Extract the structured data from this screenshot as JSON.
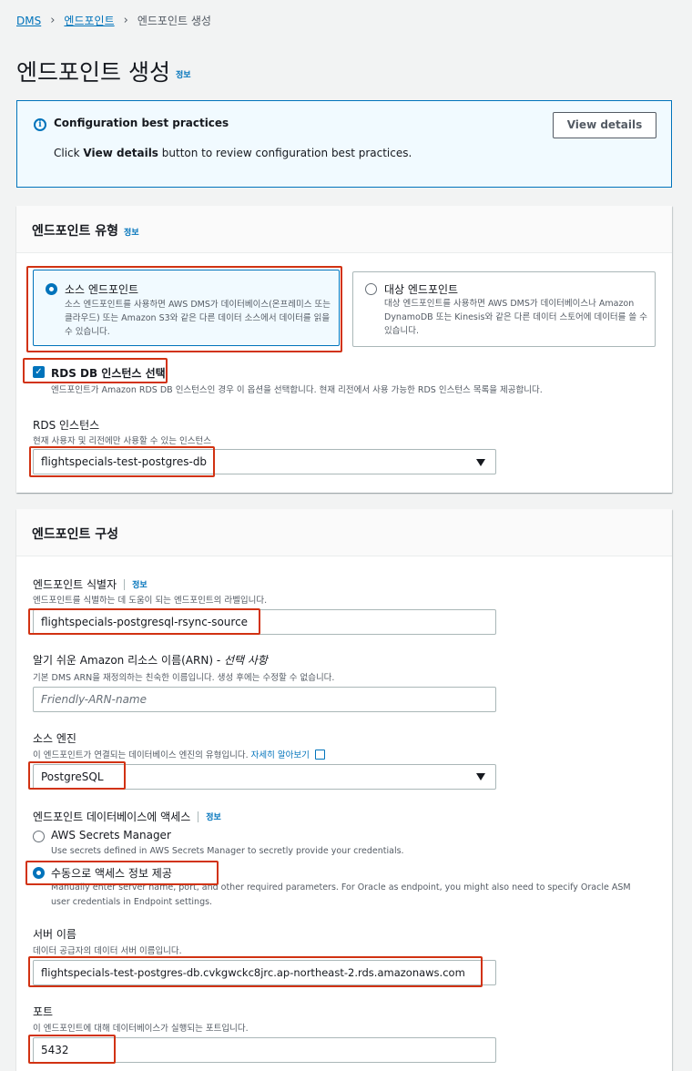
{
  "breadcrumb": {
    "item1": "DMS",
    "item2": "엔드포인트",
    "current": "엔드포인트 생성"
  },
  "page": {
    "title": "엔드포인트 생성",
    "info": "정보"
  },
  "alert": {
    "title": "Configuration best practices",
    "text_prefix": "Click ",
    "text_bold": "View details",
    "text_suffix": " button to review configuration best practices.",
    "button": "View details"
  },
  "endpoint_type": {
    "title": "엔드포인트 유형",
    "info": "정보",
    "source": {
      "title": "소스 엔드포인트",
      "desc": "소스 엔드포인트를 사용하면 AWS DMS가 데이터베이스(온프레미스 또는 클라우드) 또는 Amazon S3와 같은 다른 데이터 소스에서 데이터를 읽을 수 있습니다.",
      "selected": true
    },
    "target": {
      "title": "대상 엔드포인트",
      "desc": "대상 엔드포인트를 사용하면 AWS DMS가 데이터베이스나 Amazon DynamoDB 또는 Kinesis와 같은 다른 데이터 스토어에 데이터를 쓸 수 있습니다.",
      "selected": false
    },
    "rds_checkbox": {
      "label": "RDS DB 인스턴스 선택",
      "desc": "엔드포인트가 Amazon RDS DB 인스턴스인 경우 이 옵션을 선택합니다. 현재 리전에서 사용 가능한 RDS 인스턴스 목록을 제공합니다.",
      "checked": true
    },
    "rds_instance": {
      "label": "RDS 인스턴스",
      "desc": "현재 사용자 및 리전에만 사용할 수 있는 인스턴스",
      "value": "flightspecials-test-postgres-db"
    }
  },
  "endpoint_config": {
    "title": "엔드포인트 구성",
    "identifier": {
      "label": "엔드포인트 식별자",
      "info": "정보",
      "desc": "엔드포인트를 식별하는 데 도움이 되는 엔드포인트의 라벨입니다.",
      "value": "flightspecials-postgresql-rsync-source"
    },
    "arn": {
      "label": "알기 쉬운 Amazon 리소스 이름(ARN) - ",
      "label_optional": "선택 사항",
      "desc": "기본 DMS ARN을 재정의하는 친숙한 이름입니다. 생성 후에는 수정할 수 없습니다.",
      "placeholder": "Friendly-ARN-name"
    },
    "source_engine": {
      "label": "소스 엔진",
      "desc": "이 엔드포인트가 연결되는 데이터베이스 엔진의 유형입니다.",
      "learn_more": "자세히 알아보기",
      "value": "PostgreSQL"
    },
    "access": {
      "label": "엔드포인트 데이터베이스에 액세스",
      "info": "정보",
      "option1": {
        "title": "AWS Secrets Manager",
        "desc": "Use secrets defined in AWS Secrets Manager to secretly provide your credentials.",
        "selected": false
      },
      "option2": {
        "title": "수동으로 액세스 정보 제공",
        "desc_line1": "Manually enter server name, port, and other required parameters. For Oracle as endpoint, you might also need to specify Oracle ASM",
        "desc_line2": "user credentials in Endpoint settings.",
        "selected": true
      }
    },
    "server_name": {
      "label": "서버 이름",
      "desc": "데이터 공급자의 데이터 서버 이름입니다.",
      "value": "flightspecials-test-postgres-db.cvkgwckc8jrc.ap-northeast-2.rds.amazonaws.com"
    },
    "port": {
      "label": "포트",
      "desc": "이 엔드포인트에 대해 데이터베이스가 실행되는 포트입니다.",
      "value": "5432"
    }
  },
  "colors": {
    "accent": "#0073bb",
    "highlight": "#d13212"
  }
}
